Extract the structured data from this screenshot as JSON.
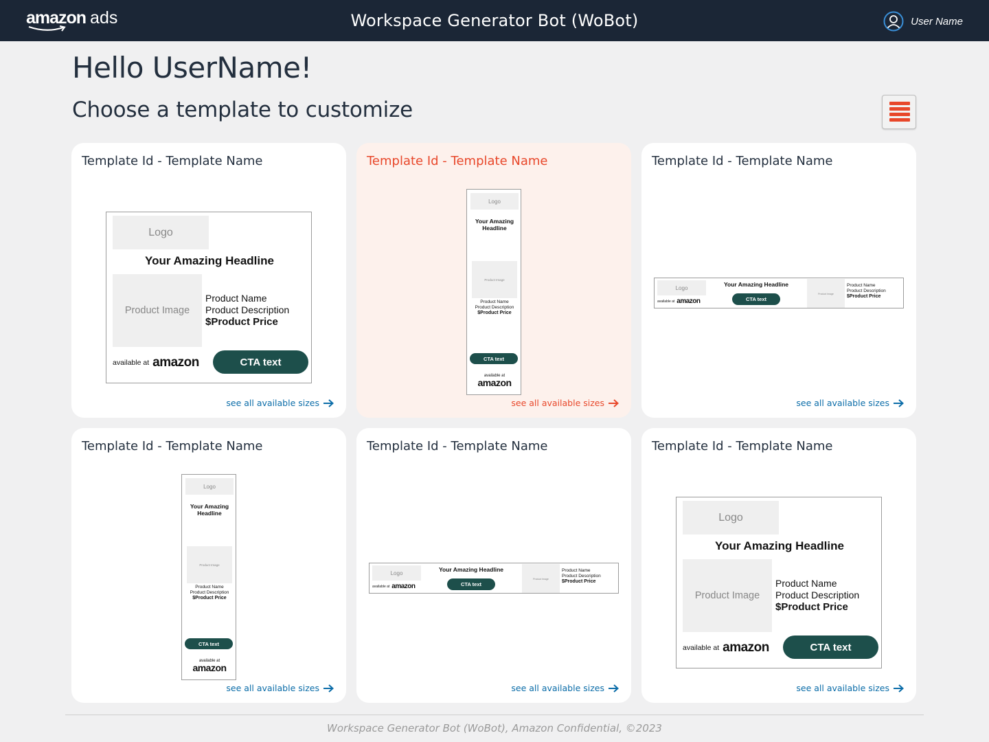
{
  "header": {
    "brand_word": "amazon",
    "brand_suffix": "ads",
    "app_title": "Workspace Generator Bot (WoBot)",
    "user_name": "User Name",
    "user_icon": "user-circle-icon"
  },
  "greeting": "Hello UserName!",
  "subtitle": "Choose a template to customize",
  "menu_icon": "hamburger-menu-icon",
  "colors": {
    "header_bg": "#1b2636",
    "accent_orange": "#e8472a",
    "cta_green": "#1d4f4b",
    "link_blue": "#0a6ca8",
    "selected_card_bg": "#fdf1ec"
  },
  "ad": {
    "logo": "Logo",
    "headline": "Your Amazing Headline",
    "product_image": "Product Image",
    "product_name": "Product Name",
    "product_description": "Product Description",
    "product_price": "$Product Price",
    "available_at": "available at",
    "amazon": "amazon",
    "cta": "CTA text"
  },
  "cards": [
    {
      "title": "Template Id - Template Name",
      "link": "see all available sizes",
      "format": "medium-rectangle",
      "selected": false
    },
    {
      "title": "Template Id - Template Name",
      "link": "see all available sizes",
      "format": "skyscraper",
      "selected": true
    },
    {
      "title": "Template Id - Template Name",
      "link": "see all available sizes",
      "format": "leaderboard",
      "selected": false
    },
    {
      "title": "Template Id - Template Name",
      "link": "see all available sizes",
      "format": "skyscraper",
      "selected": false
    },
    {
      "title": "Template Id - Template Name",
      "link": "see all available sizes",
      "format": "leaderboard",
      "selected": false
    },
    {
      "title": "Template Id - Template Name",
      "link": "see all available sizes",
      "format": "medium-rectangle",
      "selected": false
    }
  ],
  "footer": "Workspace Generator Bot (WoBot), Amazon Confidential, ©2023"
}
